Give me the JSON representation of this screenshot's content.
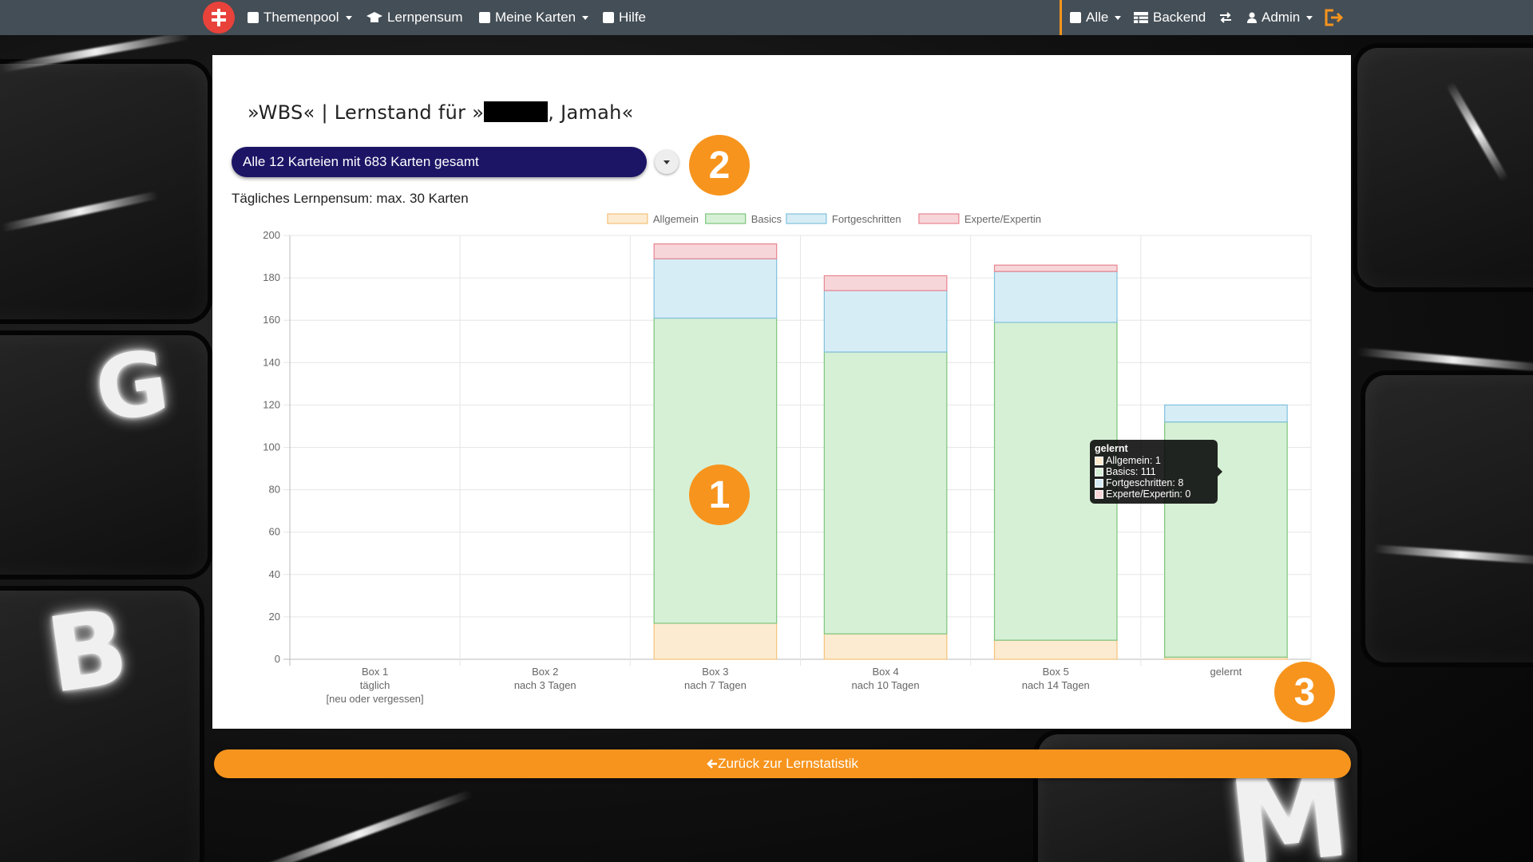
{
  "navbar": {
    "themenpool": "Themenpool",
    "lernpensum": "Lernpensum",
    "meine_karten": "Meine Karten",
    "hilfe": "Hilfe",
    "alle": "Alle",
    "backend": "Backend",
    "admin": "Admin",
    "accent_color": "#f7941d",
    "bg_color": "#444e56"
  },
  "title": {
    "prefix": "»WBS« | Lernstand für »",
    "suffix": ", Jamah«"
  },
  "select": {
    "value": "Alle 12 Karteien mit 683 Karten gesamt"
  },
  "daily": "Tägliches Lernpensum: max. 30 Karten",
  "badges": [
    "1",
    "2",
    "3"
  ],
  "tooltip": {
    "title": "gelernt",
    "rows": [
      "Allgemein: 1",
      "Basics: 111",
      "Fortgeschritten: 8",
      "Experte/Expertin: 0"
    ]
  },
  "back_button": "Zurück zur Lernstatistik",
  "chart_data": {
    "type": "bar",
    "stacked": true,
    "categories": [
      [
        "Box 1",
        "täglich",
        "[neu oder vergessen]"
      ],
      [
        "Box 2",
        "nach 3 Tagen"
      ],
      [
        "Box 3",
        "nach 7 Tagen"
      ],
      [
        "Box 4",
        "nach 10 Tagen"
      ],
      [
        "Box 5",
        "nach 14 Tagen"
      ],
      [
        "gelernt"
      ]
    ],
    "series": [
      {
        "name": "Allgemein",
        "values": [
          0,
          0,
          17,
          12,
          9,
          1
        ],
        "fill": "#fcebd0",
        "stroke": "#f5c27a"
      },
      {
        "name": "Basics",
        "values": [
          0,
          0,
          144,
          133,
          150,
          111
        ],
        "fill": "#d6f0d6",
        "stroke": "#7cc47c"
      },
      {
        "name": "Fortgeschritten",
        "values": [
          0,
          0,
          28,
          29,
          24,
          8
        ],
        "fill": "#d7edf6",
        "stroke": "#7fc0dd"
      },
      {
        "name": "Experte/Expertin",
        "values": [
          0,
          0,
          7,
          7,
          3,
          0
        ],
        "fill": "#f7d6da",
        "stroke": "#e8848f"
      }
    ],
    "ylim": [
      0,
      200
    ],
    "yticks": [
      0,
      20,
      40,
      60,
      80,
      100,
      120,
      140,
      160,
      180,
      200
    ],
    "grid": true,
    "legend": "top"
  }
}
